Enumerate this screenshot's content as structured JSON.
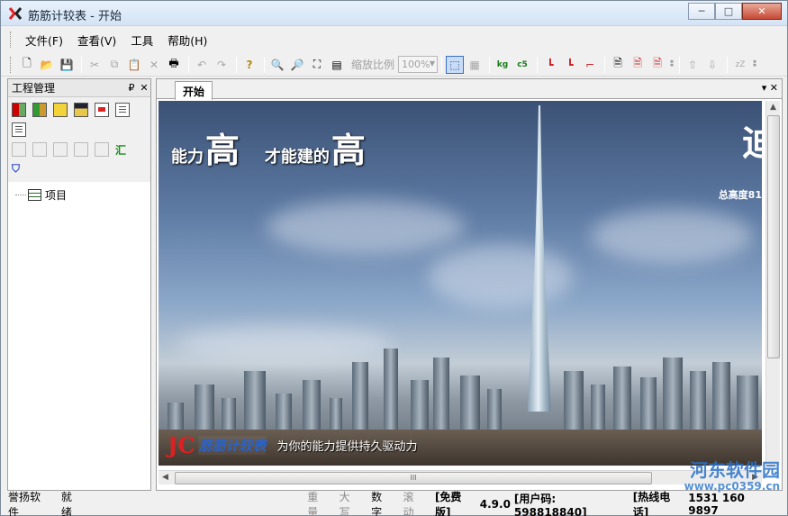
{
  "window": {
    "title": "筋筋计较表 - 开始",
    "controls": [
      "─",
      "□",
      "✕"
    ]
  },
  "menu": [
    "文件(F)",
    "查看(V)",
    "工具",
    "帮助(H)"
  ],
  "toolbar": {
    "zoom_label": "缩放比例",
    "zoom_value": "100%"
  },
  "left_panel": {
    "title": "工程管理",
    "pin": "₽",
    "close": "✕",
    "tree_item": "项目"
  },
  "tabs": [
    {
      "label": "开始"
    }
  ],
  "tab_controls": {
    "dropdown": "▾",
    "close": "✕"
  },
  "banner": {
    "slogan_a_small": "能力",
    "slogan_a_big": "高",
    "slogan_b_small": "才能建的",
    "slogan_b_big": "高",
    "right_big": "迪",
    "right_small": "总高度81",
    "brand_logo": "JC",
    "brand_name": "筋筋计较表",
    "brand_slogan": "为你的能力提供持久驱动力"
  },
  "scroll": {
    "thumb_grip": "III"
  },
  "status": {
    "company": "誉扬软件",
    "state": "就绪",
    "weight": "重量",
    "caps": "大写",
    "num": "数字",
    "scroll": "滚动",
    "edition": "[免费版]",
    "version": "4.9.0",
    "user_code": "[用户码: 598818840]",
    "hotline": "[热线电话]",
    "phone": "1531 160 9897"
  },
  "watermark": {
    "text": "河东软件园",
    "url": "www.pc0359.cn"
  }
}
